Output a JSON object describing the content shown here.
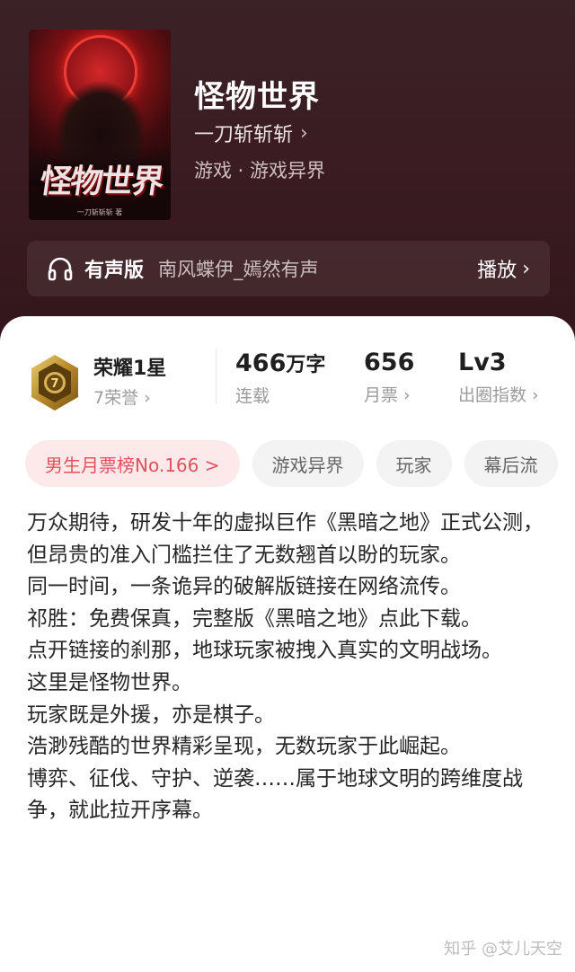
{
  "book": {
    "title": "怪物世界",
    "author": "一刀斩斩斩",
    "genre": "游戏 · 游戏异界",
    "cover": {
      "title_art": "怪物世界",
      "author_small": "一刀斩斩斩 著"
    }
  },
  "audio": {
    "label": "有声版",
    "narrator": "南风蝶伊_嫣然有声",
    "play_label": "播放",
    "icon": "headphones-icon"
  },
  "honor": {
    "title": "荣耀1星",
    "subtitle": "7荣誉",
    "badge_number": "7"
  },
  "stats": {
    "words_value": "466",
    "words_unit": "万字",
    "words_label": "连载",
    "tickets_value": "656",
    "tickets_label": "月票",
    "level_value": "Lv3",
    "level_label": "出圈指数"
  },
  "tags": {
    "rank": "男生月票榜No.166 >",
    "t1": "游戏异界",
    "t2": "玩家",
    "t3": "幕后流"
  },
  "synopsis": [
    "万众期待，研发十年的虚拟巨作《黑暗之地》正式公测，但昂贵的准入门槛拦住了无数翘首以盼的玩家。",
    "同一时间，一条诡异的破解版链接在网络流传。",
    "祁胜：免费保真，完整版《黑暗之地》点此下载。",
    "点开链接的刹那，地球玩家被拽入真实的文明战场。",
    "这里是怪物世界。",
    "玩家既是外援，亦是棋子。",
    "浩渺残酷的世界精彩呈现，无数玩家于此崛起。",
    "博弈、征伐、守护、逆袭……属于地球文明的跨维度战争，就此拉开序幕。"
  ],
  "watermark": "知乎 @艾儿天空",
  "colors": {
    "header_bg": "#3a1c22",
    "rank_tag_bg": "#fde9ea",
    "rank_tag_text": "#e2515c"
  }
}
